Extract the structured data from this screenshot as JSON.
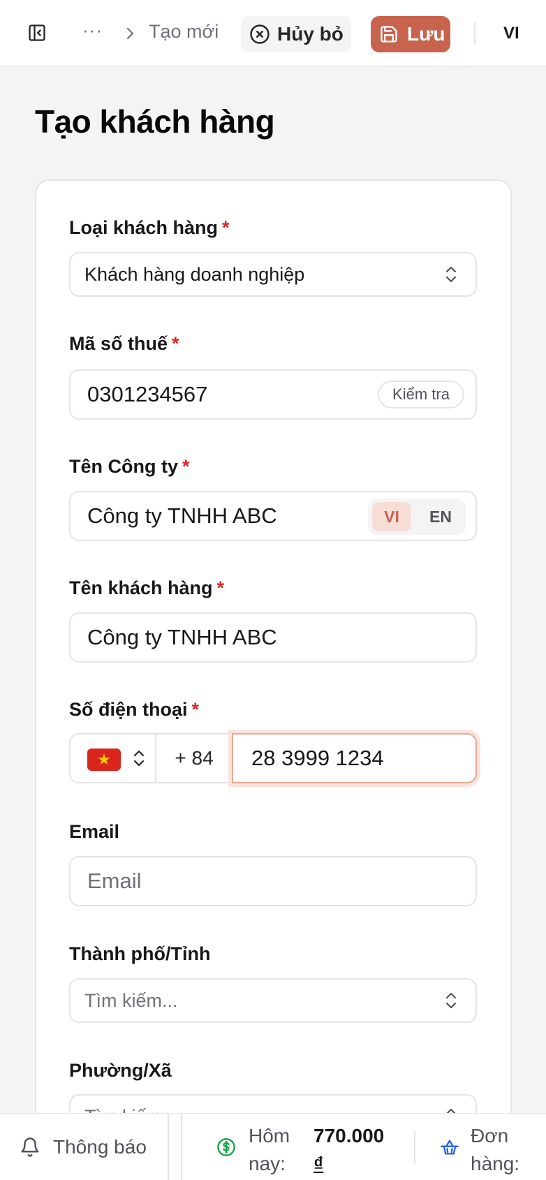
{
  "header": {
    "more_label": "···",
    "breadcrumb": "Tạo mới",
    "cancel_label": "Hủy bỏ",
    "save_label": "Lưu",
    "language": "VI"
  },
  "page": {
    "title": "Tạo khách hàng"
  },
  "form": {
    "customer_type": {
      "label": "Loại khách hàng",
      "required": "*",
      "value": "Khách hàng doanh nghiệp"
    },
    "tax_code": {
      "label": "Mã số thuế",
      "required": "*",
      "value": "0301234567",
      "check_label": "Kiểm tra"
    },
    "company_name": {
      "label": "Tên Công ty",
      "required": "*",
      "value": "Công ty TNHH ABC",
      "lang_vi": "VI",
      "lang_en": "EN"
    },
    "customer_name": {
      "label": "Tên khách hàng",
      "required": "*",
      "value": "Công ty TNHH ABC"
    },
    "phone": {
      "label": "Số điện thoại",
      "required": "*",
      "country_flag": "★",
      "dial_code": "+ 84",
      "value": "28 3999 1234"
    },
    "email": {
      "label": "Email",
      "placeholder": "Email"
    },
    "city": {
      "label": "Thành phố/Tỉnh",
      "placeholder": "Tìm kiếm..."
    },
    "ward": {
      "label": "Phường/Xã",
      "placeholder": "Tìm kiếm..."
    }
  },
  "footer": {
    "notifications_label": "Thông báo",
    "today_label": "Hôm nay:",
    "today_value": "770.000",
    "today_currency": "₫",
    "orders_label": "Đơn hàng:"
  },
  "colors": {
    "accent": "#c8634d",
    "required": "#dc2626",
    "money_icon": "#16a34a",
    "basket_icon": "#2563eb"
  }
}
